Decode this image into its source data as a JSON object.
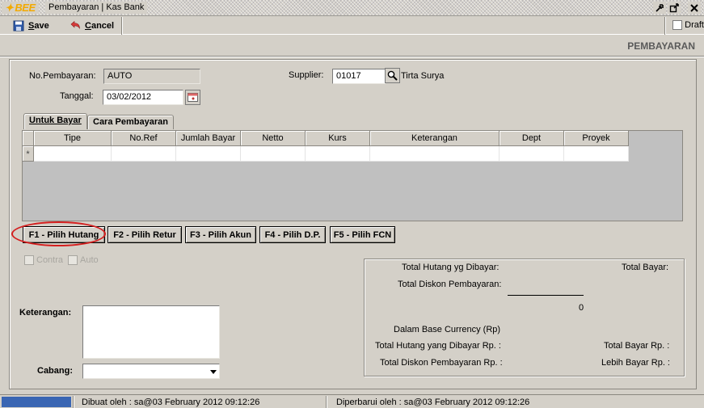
{
  "window": {
    "logo": "BEE",
    "title": "Pembayaran | Kas Bank"
  },
  "toolbar": {
    "save_label": "ave",
    "save_key": "S",
    "cancel_label": "ancel",
    "cancel_key": "C",
    "draft_label": "Draft"
  },
  "header": {
    "title": "PEMBAYARAN"
  },
  "form": {
    "no_pembayaran_label": "No.Pembayaran:",
    "no_pembayaran_value": "AUTO",
    "tanggal_label": "Tanggal:",
    "tanggal_value": "03/02/2012",
    "supplier_label": "Supplier:",
    "supplier_code": "01017",
    "supplier_name": "Tirta Surya"
  },
  "tabs": [
    {
      "label": "Untuk Bayar",
      "active": true
    },
    {
      "label": "Cara Pembayaran",
      "active": false
    }
  ],
  "grid": {
    "columns": [
      "Tipe",
      "No.Ref",
      "Jumlah Bayar",
      "Netto",
      "Kurs",
      "Keterangan",
      "Dept",
      "Proyek"
    ],
    "new_row_marker": "*"
  },
  "function_buttons": [
    {
      "label": "F1 - Pilih Hutang"
    },
    {
      "label": "F2 - Pilih Retur"
    },
    {
      "label": "F3 - Pilih Akun"
    },
    {
      "label": "F4 - Pilih D.P."
    },
    {
      "label": "F5 - Pilih FCN"
    }
  ],
  "options": {
    "contra_label": "Contra",
    "auto_label": "Auto"
  },
  "notes": {
    "keterangan_label": "Keterangan:",
    "cabang_label": "Cabang:"
  },
  "totals": {
    "total_hutang_dibayar": "Total Hutang yg Dibayar:",
    "total_bayar": "Total Bayar:",
    "total_diskon": "Total Diskon Pembayaran:",
    "sum_value": "0",
    "base_currency": "Dalam Base Currency (Rp)",
    "total_hutang_rp": "Total Hutang yang Dibayar Rp. :",
    "total_bayar_rp": "Total Bayar Rp. :",
    "total_diskon_rp": "Total Diskon Pembayaran Rp. :",
    "lebih_bayar_rp": "Lebih Bayar Rp. :"
  },
  "status": {
    "created": "Dibuat oleh : sa@03 February 2012  09:12:26",
    "updated": "Diperbarui oleh : sa@03 February 2012  09:12:26"
  },
  "colors": {
    "window_bg": "#d4d0c8",
    "highlight_ring": "#d41e1e",
    "status_progress": "#3a66b3"
  }
}
